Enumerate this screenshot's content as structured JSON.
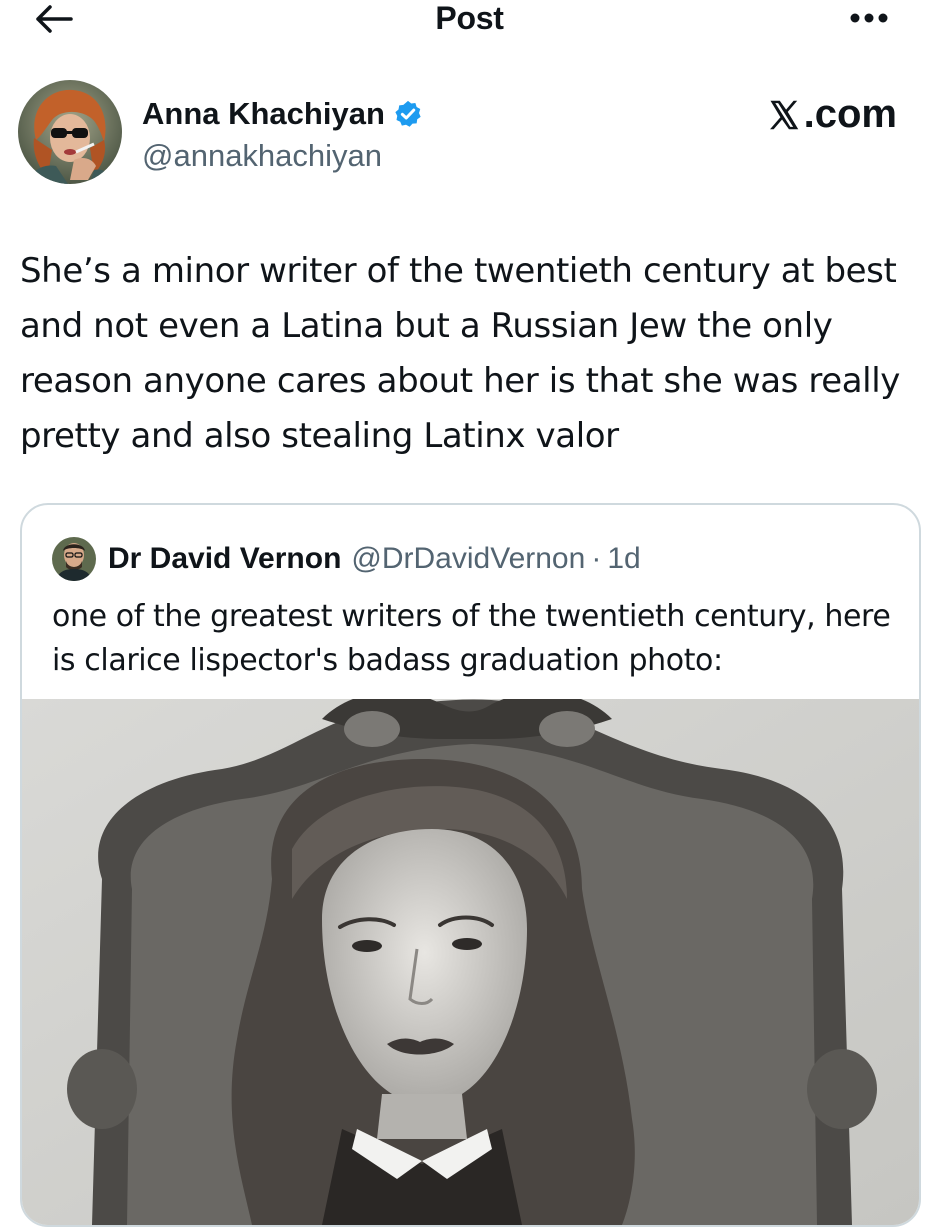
{
  "header": {
    "title": "Post",
    "back_icon": "arrow-left-icon",
    "more_icon": "more-horizontal-icon"
  },
  "tweet": {
    "author": {
      "display_name": "Anna Khachiyan",
      "handle": "@annakhachiyan",
      "verified": true,
      "verified_color": "#1d9bf0"
    },
    "site_mark": ".com",
    "text": "She’s a minor writer of the twentieth century at best and not even a Latina but a Russian Jew the only reason anyone cares about her is that she was really pretty and also stealing Latinx valor"
  },
  "quote": {
    "author": {
      "display_name": "Dr David Vernon",
      "handle": "@DrDavidVernon",
      "separator": "·",
      "time": "1d"
    },
    "text": "one of the greatest writers of the twentieth century, here is clarice lispector's badass graduation photo:"
  },
  "colors": {
    "text_primary": "#0f1419",
    "text_secondary": "#536471",
    "border": "#cfd9de",
    "accent": "#1d9bf0"
  }
}
